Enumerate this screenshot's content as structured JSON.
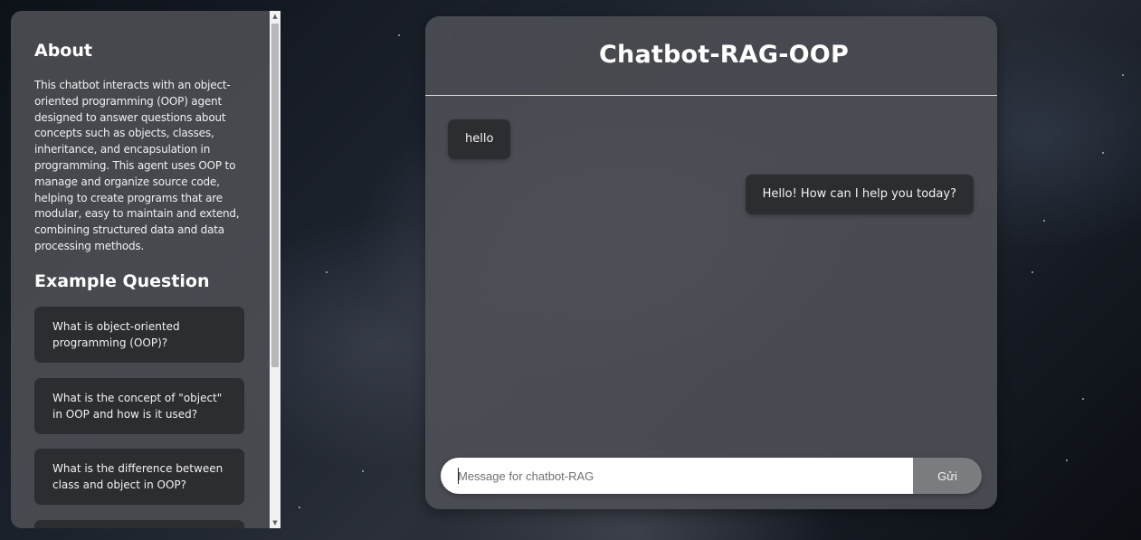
{
  "sidebar": {
    "about_title": "About",
    "about_text": "This chatbot interacts with an object-oriented programming (OOP) agent designed to answer questions about concepts such as objects, classes, inheritance, and encapsulation in programming. This agent uses OOP to manage and organize source code, helping to create programs that are modular, easy to maintain and extend, combining structured data and data processing methods.",
    "example_title": "Example Question",
    "questions": [
      "What is object-oriented programming (OOP)?",
      "What is the concept of \"object\" in OOP and how is it used?",
      "What is the difference between class and object in OOP?",
      ""
    ],
    "scroll_up_icon": "triangle-up",
    "scroll_down_icon": "triangle-down"
  },
  "chat": {
    "title": "Chatbot-RAG-OOP",
    "messages": [
      {
        "role": "user",
        "text": "hello"
      },
      {
        "role": "bot",
        "text": "Hello! How can I help you today?"
      }
    ],
    "input_placeholder": "Message for chatbot-RAG",
    "input_value": "",
    "send_label": "Gửi"
  },
  "colors": {
    "panel": "#4e5056",
    "bubble": "#2c2d31",
    "send_button": "#7b7c80"
  }
}
